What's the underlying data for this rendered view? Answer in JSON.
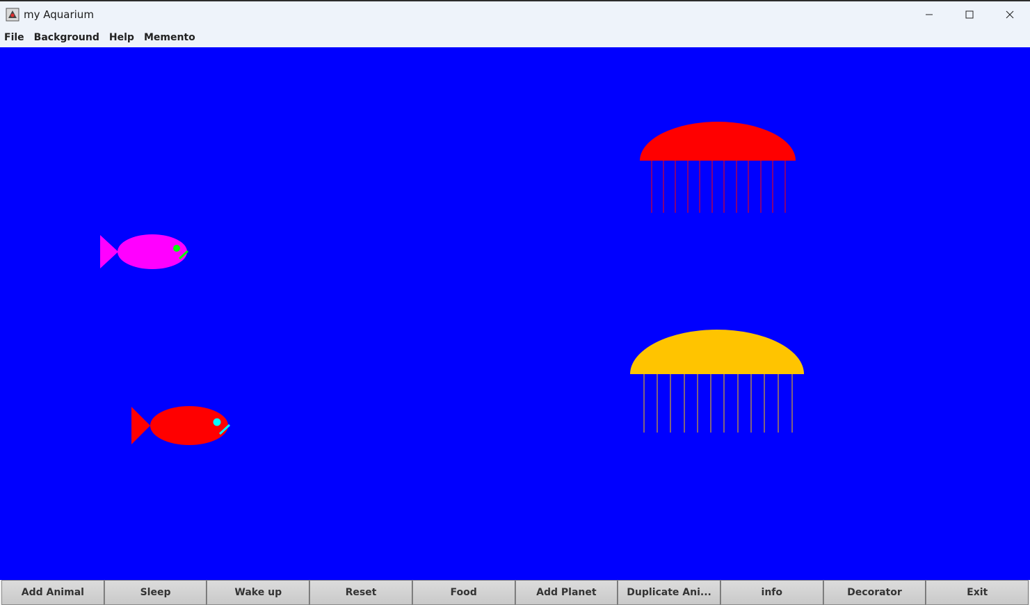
{
  "window": {
    "title": "my Aquarium",
    "icons": {
      "app": "aquarium-app-icon",
      "minimize": "minimize-icon",
      "maximize": "maximize-icon",
      "close": "close-icon"
    }
  },
  "menu": {
    "items": [
      "File",
      "Background",
      "Help",
      "Memento"
    ]
  },
  "aquarium": {
    "background_color": "#0000ff",
    "fish": [
      {
        "body_color": "#ff00ff",
        "eye_color": "#00ff00"
      },
      {
        "body_color": "#ff0000",
        "eye_color": "#00ffff"
      }
    ],
    "jellyfish": [
      {
        "color": "#ff0000"
      },
      {
        "color": "#ffc400"
      }
    ]
  },
  "buttons": [
    "Add Animal",
    "Sleep",
    "Wake up",
    "Reset",
    "Food",
    "Add Planet",
    "Duplicate Ani...",
    "info",
    "Decorator",
    "Exit"
  ]
}
